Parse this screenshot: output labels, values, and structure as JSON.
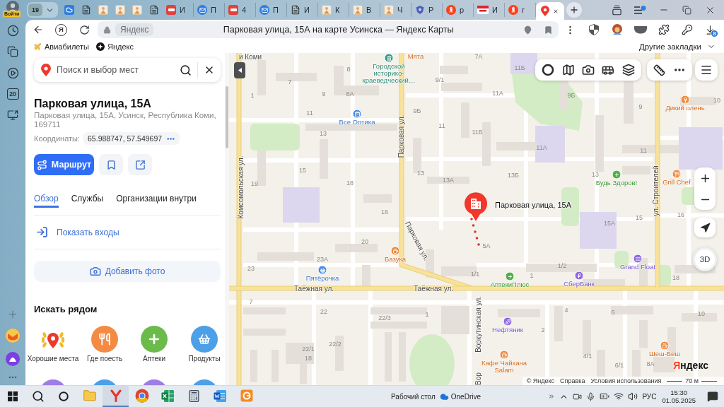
{
  "browser": {
    "sidebar": {
      "profile_label": "Войти",
      "calendar_day": "20"
    },
    "tab_strip": {
      "tab_count": "19",
      "tabs": [
        {
          "kind": "cloud",
          "selected": false
        },
        {
          "kind": "document",
          "selected": false
        },
        {
          "kind": "image",
          "selected": false
        },
        {
          "kind": "image",
          "selected": false
        },
        {
          "kind": "image",
          "selected": false
        },
        {
          "kind": "document",
          "selected": false
        },
        {
          "kind": "pdf",
          "title": "И",
          "selected": false
        },
        {
          "kind": "mail",
          "title": "П",
          "selected": false
        },
        {
          "kind": "pdf",
          "title": "4",
          "selected": false
        },
        {
          "kind": "mail",
          "title": "П",
          "selected": false
        },
        {
          "kind": "document",
          "title": "И",
          "selected": false
        },
        {
          "kind": "image",
          "title": "К",
          "selected": false
        },
        {
          "kind": "image",
          "title": "В",
          "selected": false
        },
        {
          "kind": "image",
          "title": "Ч",
          "selected": false
        },
        {
          "kind": "emblem",
          "title": "Р",
          "selected": false
        },
        {
          "kind": "logo",
          "title": "р",
          "selected": false
        },
        {
          "kind": "rts",
          "title": "И",
          "selected": false
        },
        {
          "kind": "logo",
          "title": "г",
          "selected": false
        },
        {
          "kind": "map-pin",
          "selected": true
        }
      ]
    },
    "toolbar": {
      "home_logo": "Я",
      "site": "Яндекс",
      "page_title": "Парковая улица, 15А на карте Усинска — Яндекс Карты",
      "downloads_badge": "8"
    },
    "bookmarks": {
      "items": [
        {
          "kind": "plane",
          "label": "Авиабилеты"
        },
        {
          "kind": "logo",
          "label": "Яндекс"
        }
      ],
      "other_label": "Другие закладки"
    }
  },
  "place_panel": {
    "search": {
      "placeholder": "Поиск и выбор мест"
    },
    "title": "Парковая улица, 15А",
    "address": "Парковая улица, 15А, Усинск, Республика Коми, 169711",
    "coordinates_label": "Координаты:",
    "coordinates": "65.988747, 57.549697",
    "route_button": "Маршрут",
    "tabs": [
      {
        "label": "Обзор",
        "selected": true
      },
      {
        "label": "Службы",
        "selected": false
      },
      {
        "label": "Организации внутри",
        "selected": false
      }
    ],
    "entrances_link": "Показать входы",
    "add_photo_button": "Добавить фото",
    "nearby": {
      "heading": "Искать рядом",
      "categories": [
        {
          "kind": "good-places",
          "label": "Хорошие места"
        },
        {
          "kind": "food",
          "label": "Где поесть"
        },
        {
          "kind": "pharmacy",
          "label": "Аптеки"
        },
        {
          "kind": "groceries",
          "label": "Продукты"
        }
      ],
      "more_categories": [
        {
          "color": "#a07de6"
        },
        {
          "color": "#4d9fe8"
        },
        {
          "color": "#a07de6"
        },
        {
          "color": "#4d9fe8"
        }
      ]
    }
  },
  "map": {
    "streets": [
      "и Коми",
      "Парковая ул.",
      "Комсомольская ул.",
      "ул. Строителей",
      "Парковая ул.",
      "Таёжная ул.",
      "Таёжная ул.",
      "Воркутинская ул.",
      "Вор"
    ],
    "house_numbers": [
      "7А",
      "11Б",
      "8",
      "1",
      "7",
      "9",
      "8А",
      "9/1",
      "11А",
      "9Б",
      "11",
      "9Б",
      "11",
      "11Б",
      "11А",
      "9",
      "10",
      "13",
      "11",
      "15",
      "13",
      "13А",
      "13Б",
      "13",
      "19",
      "18",
      "16",
      "15А",
      "15",
      "16",
      "20",
      "5А",
      "23А",
      "23",
      "1/1",
      "1",
      "1/2",
      "18",
      "7",
      "22",
      "22/3",
      "1",
      "4",
      "6",
      "10",
      "2",
      "22/1",
      "22/2",
      "18",
      "4/1",
      "6/1",
      "8А"
    ],
    "places": [
      {
        "name": "Городской историко-краеведческий…",
        "kind": "museum"
      },
      {
        "name": "Мята",
        "kind": "cafe"
      },
      {
        "name": "Все Оптика",
        "kind": "optics"
      },
      {
        "name": "Дикий олень",
        "kind": "bar"
      },
      {
        "name": "Будь Здоров!",
        "kind": "pharmacy"
      },
      {
        "name": "Grill Chef",
        "kind": "restaurant"
      },
      {
        "name": "Базука",
        "kind": "cafe"
      },
      {
        "name": "Пятёрочка",
        "kind": "grocery"
      },
      {
        "name": "Grand Float",
        "kind": "sport"
      },
      {
        "name": "АптекиПлюс",
        "kind": "pharmacy"
      },
      {
        "name": "СберБанк",
        "kind": "bank"
      },
      {
        "name": "Нефтяник",
        "kind": "fitness"
      },
      {
        "name": "Шеш-Беш",
        "kind": "cafe"
      },
      {
        "name": "Кафе Чайхана Salam",
        "kind": "cafe"
      }
    ],
    "marker": {
      "label": "Парковая улица, 15А"
    },
    "view_3d_button": "3D",
    "logo": "Яндекс",
    "attribution": [
      "© Яндекс",
      "Справка",
      "Условия использования"
    ],
    "scale": "70 м"
  },
  "taskbar": {
    "apps": [
      {
        "kind": "folder",
        "selected": false
      },
      {
        "kind": "browser-y",
        "selected": true
      },
      {
        "kind": "chrome",
        "selected": false
      },
      {
        "kind": "spreadsheet",
        "selected": false
      },
      {
        "kind": "calculator",
        "selected": false
      },
      {
        "kind": "document",
        "selected": false
      },
      {
        "kind": "orange-app",
        "selected": false
      }
    ],
    "desktop_label": "Рабочий стол",
    "onedrive_label": "OneDrive",
    "language": "РУС",
    "time": "15:30",
    "date": "01.05.2025"
  }
}
